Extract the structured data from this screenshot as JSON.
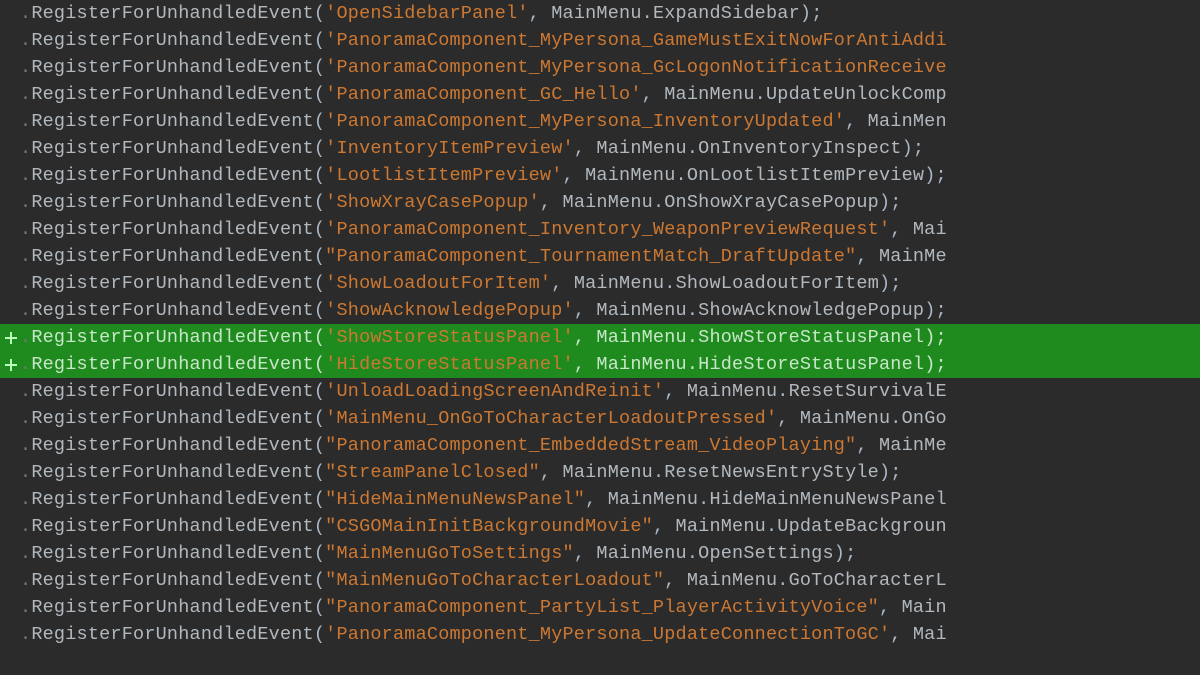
{
  "fnName": "RegisterForUnhandledEvent",
  "objName": "MainMenu",
  "lines": [
    {
      "quote": "'",
      "event": "OpenSidebarPanel",
      "handler": "ExpandSidebar",
      "tailPunc": ");",
      "added": false
    },
    {
      "quote": "'",
      "event": "PanoramaComponent_MyPersona_GameMustExitNowForAntiAddi",
      "handler": "",
      "tailPunc": "",
      "added": false
    },
    {
      "quote": "'",
      "event": "PanoramaComponent_MyPersona_GcLogonNotificationReceive",
      "handler": "",
      "tailPunc": "",
      "added": false
    },
    {
      "quote": "'",
      "event": "PanoramaComponent_GC_Hello",
      "handler": "UpdateUnlockComp",
      "tailPunc": "",
      "added": false,
      "noClose": true
    },
    {
      "quote": "'",
      "event": "PanoramaComponent_MyPersona_InventoryUpdated",
      "handler": "",
      "tailPunc": "",
      "added": false,
      "objOnly": true
    },
    {
      "quote": "'",
      "event": "InventoryItemPreview",
      "handler": "OnInventoryInspect",
      "tailPunc": ");",
      "added": false
    },
    {
      "quote": "'",
      "event": "LootlistItemPreview",
      "handler": "OnLootlistItemPreview",
      "tailPunc": ");",
      "added": false
    },
    {
      "quote": "'",
      "event": "ShowXrayCasePopup",
      "handler": "OnShowXrayCasePopup",
      "tailPunc": ");",
      "added": false
    },
    {
      "quote": "'",
      "event": "PanoramaComponent_Inventory_WeaponPreviewRequest",
      "handler": "",
      "tailPunc": "",
      "added": false,
      "objPartial": "Mai"
    },
    {
      "quote": "\"",
      "event": "PanoramaComponent_TournamentMatch_DraftUpdate",
      "handler": "",
      "tailPunc": "",
      "added": false,
      "objPartial": "MainMe"
    },
    {
      "quote": "'",
      "event": "ShowLoadoutForItem",
      "handler": "ShowLoadoutForItem",
      "tailPunc": ");",
      "added": false
    },
    {
      "quote": "'",
      "event": "ShowAcknowledgePopup",
      "handler": "ShowAcknowledgePopup",
      "tailPunc": ");",
      "added": false
    },
    {
      "quote": "'",
      "event": "ShowStoreStatusPanel",
      "handler": "ShowStoreStatusPanel",
      "tailPunc": ");",
      "added": true
    },
    {
      "quote": "'",
      "event": "HideStoreStatusPanel",
      "handler": "HideStoreStatusPanel",
      "tailPunc": ");",
      "added": true
    },
    {
      "quote": "'",
      "event": "UnloadLoadingScreenAndReinit",
      "handler": "ResetSurvivalE",
      "tailPunc": "",
      "added": false,
      "noClose": true
    },
    {
      "quote": "'",
      "event": "MainMenu_OnGoToCharacterLoadoutPressed",
      "handler": "OnGo",
      "tailPunc": "",
      "added": false,
      "noClose": true
    },
    {
      "quote": "\"",
      "event": "PanoramaComponent_EmbeddedStream_VideoPlaying",
      "handler": "",
      "tailPunc": "",
      "added": false,
      "objPartial": "MainMe"
    },
    {
      "quote": "\"",
      "event": "StreamPanelClosed",
      "handler": "ResetNewsEntryStyle",
      "tailPunc": ");",
      "added": false
    },
    {
      "quote": "\"",
      "event": "HideMainMenuNewsPanel",
      "handler": "HideMainMenuNewsPanel",
      "tailPunc": "",
      "added": false,
      "noClose": true
    },
    {
      "quote": "\"",
      "event": "CSGOMainInitBackgroundMovie",
      "handler": "UpdateBackgroun",
      "tailPunc": "",
      "added": false,
      "noClose": true
    },
    {
      "quote": "\"",
      "event": "MainMenuGoToSettings",
      "handler": "OpenSettings",
      "tailPunc": ");",
      "added": false
    },
    {
      "quote": "\"",
      "event": "MainMenuGoToCharacterLoadout",
      "handler": "GoToCharacterL",
      "tailPunc": "",
      "added": false,
      "noClose": true
    },
    {
      "quote": "\"",
      "event": "PanoramaComponent_PartyList_PlayerActivityVoice",
      "handler": "",
      "tailPunc": "",
      "added": false,
      "objPartial": "Main"
    },
    {
      "quote": "'",
      "event": "PanoramaComponent_MyPersona_UpdateConnectionToGC",
      "handler": "",
      "tailPunc": "",
      "added": false,
      "objPartial": "Mai"
    }
  ]
}
